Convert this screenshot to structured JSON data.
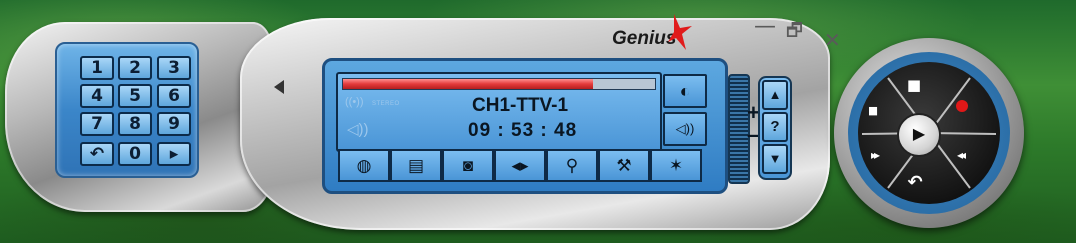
{
  "app": {
    "brand": "Genius",
    "window_controls": {
      "minimize": "—",
      "restore": "🗗",
      "close": "✕"
    }
  },
  "keypad": {
    "keys": [
      {
        "label": "1",
        "name": "key-1"
      },
      {
        "label": "2",
        "name": "key-2"
      },
      {
        "label": "3",
        "name": "key-3"
      },
      {
        "label": "4",
        "name": "key-4"
      },
      {
        "label": "5",
        "name": "key-5"
      },
      {
        "label": "6",
        "name": "key-6"
      },
      {
        "label": "7",
        "name": "key-7"
      },
      {
        "label": "8",
        "name": "key-8"
      },
      {
        "label": "9",
        "name": "key-9"
      },
      {
        "label": "↶",
        "name": "key-return-icon"
      },
      {
        "label": "0",
        "name": "key-0"
      },
      {
        "label": "▸",
        "name": "key-enter-icon"
      }
    ]
  },
  "display": {
    "channel": "CH1-TTV-1",
    "time": "09 : 53 : 48",
    "stereo_label": "STEREO",
    "progress": 0.8
  },
  "side_buttons": [
    {
      "name": "rotate-icon",
      "glyph": "◐"
    },
    {
      "name": "speaker-icon",
      "glyph": "◁))"
    }
  ],
  "bottom_buttons": [
    {
      "name": "globe-icon",
      "glyph": "◍"
    },
    {
      "name": "window-icon",
      "glyph": "▤"
    },
    {
      "name": "snapshot-icon",
      "glyph": "◙"
    },
    {
      "name": "swap-icon",
      "glyph": "◂▸"
    },
    {
      "name": "search-icon",
      "glyph": "⚲"
    },
    {
      "name": "settings-icon",
      "glyph": "⚒"
    },
    {
      "name": "bug-icon",
      "glyph": "✶"
    }
  ],
  "volume": {
    "plus": "+",
    "minus": "–",
    "up": "▲",
    "help": "?",
    "down": "▼"
  },
  "transport": {
    "stop": "■",
    "pause": "▮▮",
    "play": "▶",
    "forward": "▸▸",
    "rewind": "◂◂",
    "back": "↶"
  },
  "colors": {
    "panel_blue": "#2f7cc3",
    "lcd_blue": "#7bbdf0",
    "progress_red": "#e43b3b",
    "record_red": "#e01818"
  }
}
